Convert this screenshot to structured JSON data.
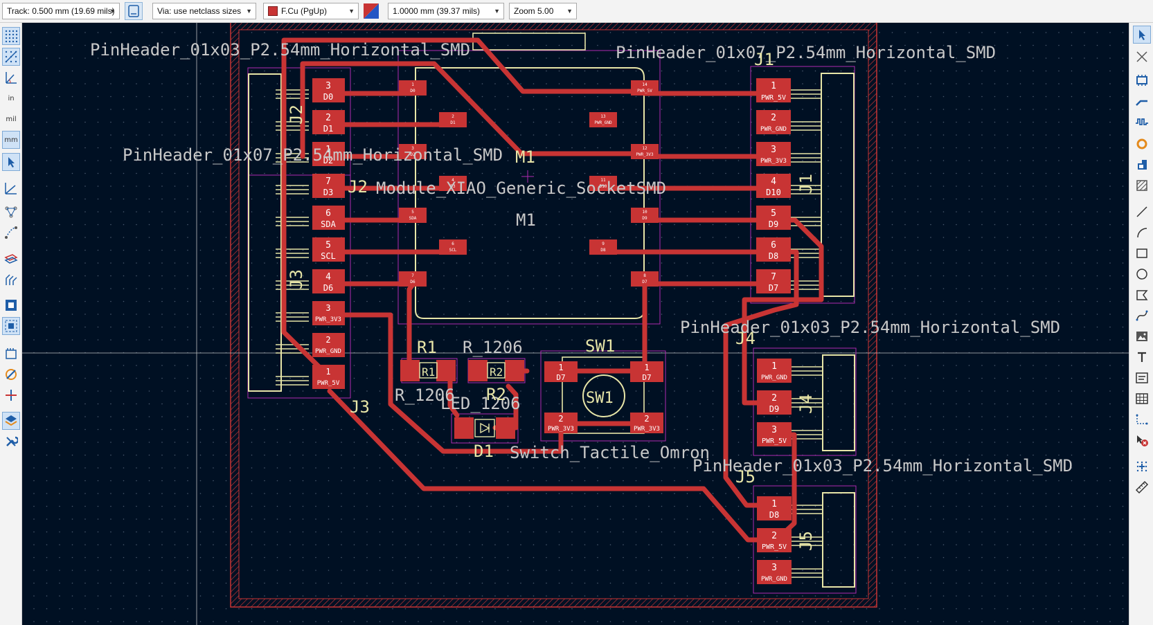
{
  "toolbar": {
    "track": "Track: 0.500 mm (19.69 mils)",
    "via": "Via: use netclass sizes",
    "layer": "F.Cu (PgUp)",
    "grid": "1.0000 mm (39.37 mils)",
    "zoom": "Zoom 5.00"
  },
  "left_toolbar": {
    "unit_in": "in",
    "unit_mil": "mil",
    "unit_mm": "mm"
  },
  "colors": {
    "copper": "#c83434",
    "background": "#001023",
    "silkscreen": "#e8e6a8",
    "courtyard": "#b02ab0",
    "edge_cuts": "#c83434"
  },
  "board": {
    "labels": {
      "j2_fp": "PinHeader_01x03_P2.54mm_Horizontal_SMD",
      "j1_fp": "PinHeader_01x07_P2.54mm_Horizontal_SMD",
      "j3_fp": "PinHeader_01x07_P2.54mm_Horizontal_SMD",
      "j4_fp": "PinHeader_01x03_P2.54mm_Horizontal_SMD",
      "j5_fp": "PinHeader_01x03_P2.54mm_Horizontal_SMD",
      "m1_fp": "Module_XIAO_Generic_SocketSMD",
      "m1_val": "M1",
      "m1_ref": "M1",
      "j1_ref": "J1",
      "j2_ref": "J2",
      "j2_vert": "J2",
      "j3_ref": "J3",
      "j3_vert": "J3",
      "j1_vert": "J1",
      "j4_ref": "J4",
      "j4_vert": "J4",
      "j5_ref": "J5",
      "j5_vert": "J5",
      "r1_ref": "R1",
      "r1_val": "R_1206",
      "r2_ref": "R2",
      "r2_val": "R_1206",
      "d1_ref": "D1",
      "d1_val": "LED_1206",
      "sw1_ref": "SW1",
      "sw1_val": "Switch_Tactile_Omron",
      "sw1_center": "SW1",
      "r1_center": "R1",
      "r2_center": "R2"
    },
    "pads": {
      "j2_1": {
        "num": "3",
        "net": "D0"
      },
      "j2_2": {
        "num": "2",
        "net": "D1"
      },
      "j2_3": {
        "num": "1",
        "net": "D2"
      },
      "j3_1": {
        "num": "7",
        "net": "D3"
      },
      "j3_2": {
        "num": "6",
        "net": "SDA"
      },
      "j3_3": {
        "num": "5",
        "net": "SCL"
      },
      "j3_4": {
        "num": "4",
        "net": "D6"
      },
      "j3_5": {
        "num": "3",
        "net": "PWR_3V3"
      },
      "j3_6": {
        "num": "2",
        "net": "PWR_GND"
      },
      "j3_7": {
        "num": "1",
        "net": "PWR_5V"
      },
      "j1_1": {
        "num": "1",
        "net": "PWR_5V"
      },
      "j1_2": {
        "num": "2",
        "net": "PWR_GND"
      },
      "j1_3": {
        "num": "3",
        "net": "PWR_3V3"
      },
      "j1_4": {
        "num": "4",
        "net": "D10"
      },
      "j1_5": {
        "num": "5",
        "net": "D9"
      },
      "j1_6": {
        "num": "6",
        "net": "D8"
      },
      "j1_7": {
        "num": "7",
        "net": "D7"
      },
      "j4_1": {
        "num": "1",
        "net": "PWR_GND"
      },
      "j4_2": {
        "num": "2",
        "net": "D9"
      },
      "j4_3": {
        "num": "3",
        "net": "PWR_5V"
      },
      "j5_1": {
        "num": "1",
        "net": "D8"
      },
      "j5_2": {
        "num": "2",
        "net": "PWR_5V"
      },
      "j5_3": {
        "num": "3",
        "net": "PWR_GND"
      },
      "sw_1a": {
        "num": "1",
        "net": "D7"
      },
      "sw_1b": {
        "num": "1",
        "net": "D7"
      },
      "sw_2a": {
        "num": "2",
        "net": "PWR_3V3"
      },
      "sw_2b": {
        "num": "2",
        "net": "PWR_3V3"
      },
      "m1_1": {
        "num": "1",
        "net": "D0"
      },
      "m1_2": {
        "num": "2",
        "net": "D1"
      },
      "m1_3": {
        "num": "3",
        "net": "D2"
      },
      "m1_4": {
        "num": "4",
        "net": "D3"
      },
      "m1_5": {
        "num": "5",
        "net": "SDA"
      },
      "m1_6": {
        "num": "6",
        "net": "SCL"
      },
      "m1_7": {
        "num": "7",
        "net": "D6"
      },
      "m1_8": {
        "num": "8",
        "net": "D7"
      },
      "m1_9": {
        "num": "9",
        "net": "D8"
      },
      "m1_10": {
        "num": "10",
        "net": "D9"
      },
      "m1_11": {
        "num": "11",
        "net": "D10"
      },
      "m1_12": {
        "num": "12",
        "net": "PWR_3V3"
      },
      "m1_13": {
        "num": "13",
        "net": "PWR_GND"
      },
      "m1_14": {
        "num": "14",
        "net": "PWR_5V"
      }
    }
  }
}
